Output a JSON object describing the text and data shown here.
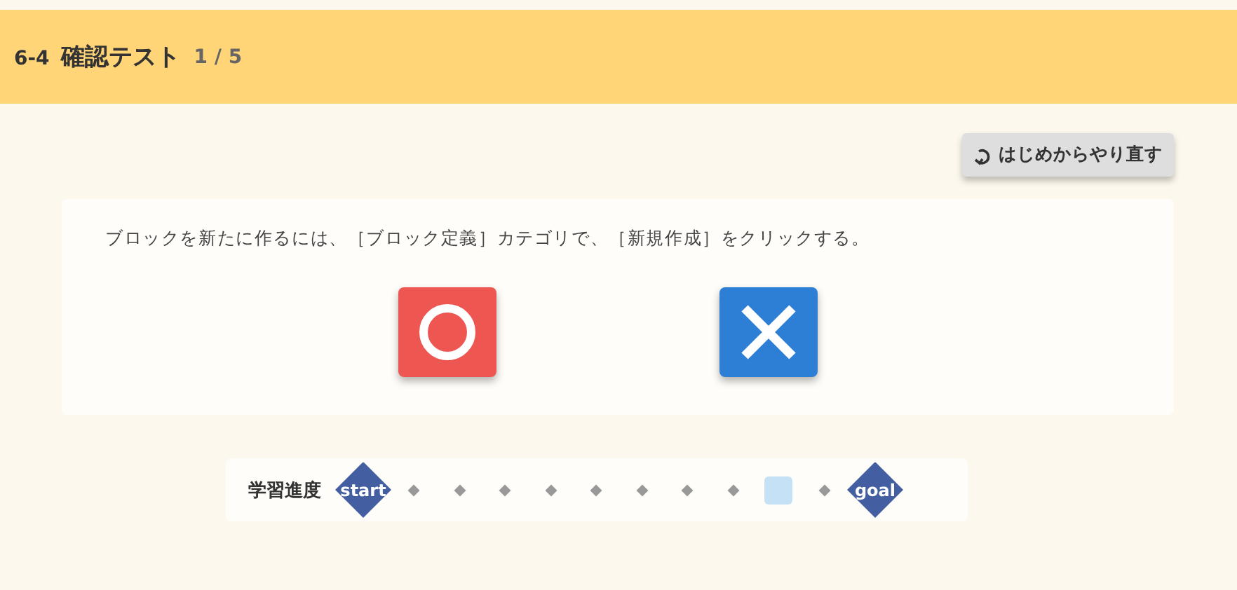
{
  "header": {
    "section": "6-4",
    "title": "確認テスト",
    "progress": "1 / 5"
  },
  "restart_button": {
    "label": "はじめからやり直す"
  },
  "question": {
    "text": "ブロックを新たに作るには、［ブロック定義］カテゴリで、［新規作成］をクリックする。"
  },
  "answers": [
    {
      "kind": "correct"
    },
    {
      "kind": "wrong"
    }
  ],
  "learning_progress": {
    "label": "学習進度",
    "start": "start",
    "goal": "goal",
    "steps": [
      {
        "current": false
      },
      {
        "current": false
      },
      {
        "current": false
      },
      {
        "current": false
      },
      {
        "current": false
      },
      {
        "current": false
      },
      {
        "current": false
      },
      {
        "current": false
      },
      {
        "current": true
      },
      {
        "current": false
      }
    ]
  }
}
